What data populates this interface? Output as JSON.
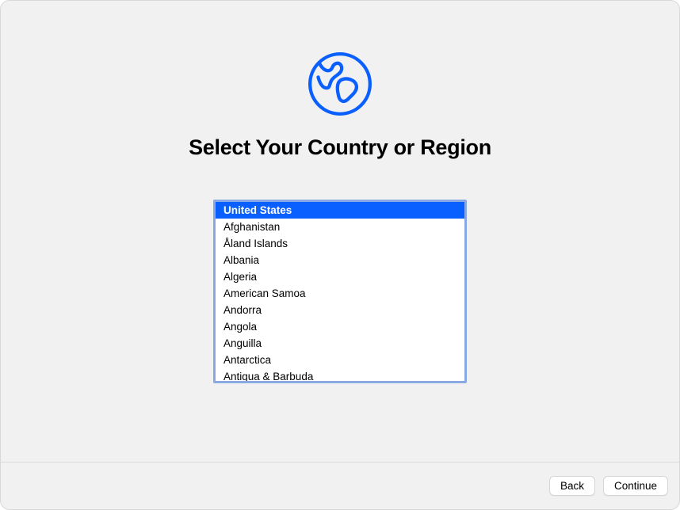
{
  "title": "Select Your Country or Region",
  "countries": [
    {
      "name": "United States",
      "selected": true
    },
    {
      "name": "Afghanistan",
      "selected": false
    },
    {
      "name": "Åland Islands",
      "selected": false
    },
    {
      "name": "Albania",
      "selected": false
    },
    {
      "name": "Algeria",
      "selected": false
    },
    {
      "name": "American Samoa",
      "selected": false
    },
    {
      "name": "Andorra",
      "selected": false
    },
    {
      "name": "Angola",
      "selected": false
    },
    {
      "name": "Anguilla",
      "selected": false
    },
    {
      "name": "Antarctica",
      "selected": false
    },
    {
      "name": "Antigua & Barbuda",
      "selected": false
    }
  ],
  "footer": {
    "back_label": "Back",
    "continue_label": "Continue"
  }
}
